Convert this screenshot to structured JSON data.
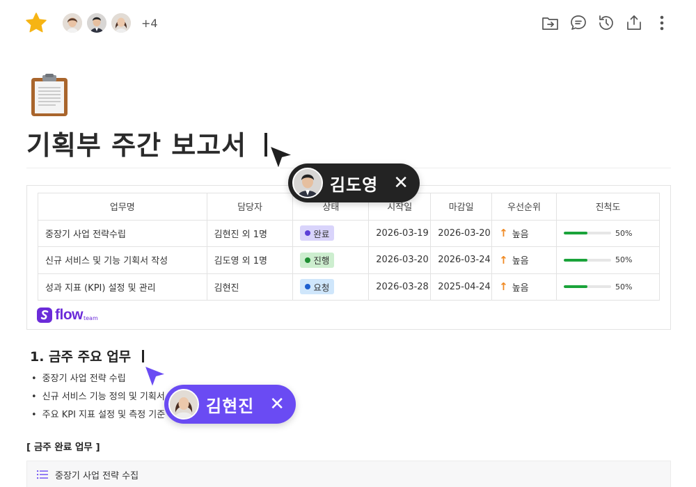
{
  "header": {
    "favorite_icon": "star-icon",
    "extra_collaborators": "+4",
    "toolbar_icons": [
      "folder-move-icon",
      "comment-icon",
      "history-icon",
      "share-icon",
      "more-vertical-icon"
    ]
  },
  "document": {
    "icon": "clipboard-icon",
    "title": "기획부 주간 보고서"
  },
  "table": {
    "columns": [
      "업무명",
      "담당자",
      "상태",
      "시작일",
      "마감일",
      "우선순위",
      "진척도"
    ],
    "rows": [
      {
        "task": "중장기 사업 전략수립",
        "owner": "김현진 외 1명",
        "status": "완료",
        "start": "2026-03-19",
        "due": "2026-03-20",
        "priority": "높음",
        "progress_label": "50%",
        "progress": 0.5
      },
      {
        "task": "신규 서비스 및 기능 기획서 작성",
        "owner": "김도영 외 1명",
        "status": "진행",
        "start": "2026-03-20",
        "due": "2026-03-24",
        "priority": "높음",
        "progress_label": "50%",
        "progress": 0.5
      },
      {
        "task": "성과 지표 (KPI) 설정 및 관리",
        "owner": "김현진",
        "status": "요청",
        "start": "2026-03-28",
        "due": "2025-04-24",
        "priority": "높음",
        "progress_label": "50%",
        "progress": 0.5
      }
    ],
    "status_colors": {
      "완료": {
        "bg": "#d9d4fb",
        "dot": "#5b3fd8"
      },
      "진행": {
        "bg": "#cdeecf",
        "dot": "#1f8f33"
      },
      "요청": {
        "bg": "#cfe6fb",
        "dot": "#1d5fcf"
      }
    },
    "brand": {
      "text": "flow",
      "sub": "team",
      "color": "#6b2bd9"
    }
  },
  "section": {
    "title": "1. 금주 주요 업무",
    "bullets": [
      "중장기 사업 전략 수립",
      "신규 서비스 기능 정의 및 기획서 작",
      "주요 KPI 지표 설정 및 측정 기준 정"
    ],
    "subheading": "[ 금주 완료 업무 ]",
    "task_item": "중장기 사업 전략 수집"
  },
  "collaborators": {
    "cursor1": {
      "name": "김도영",
      "close": "✕",
      "color": "#232323"
    },
    "cursor2": {
      "name": "김현진",
      "close": "✕",
      "color": "#6a4bf3"
    }
  }
}
